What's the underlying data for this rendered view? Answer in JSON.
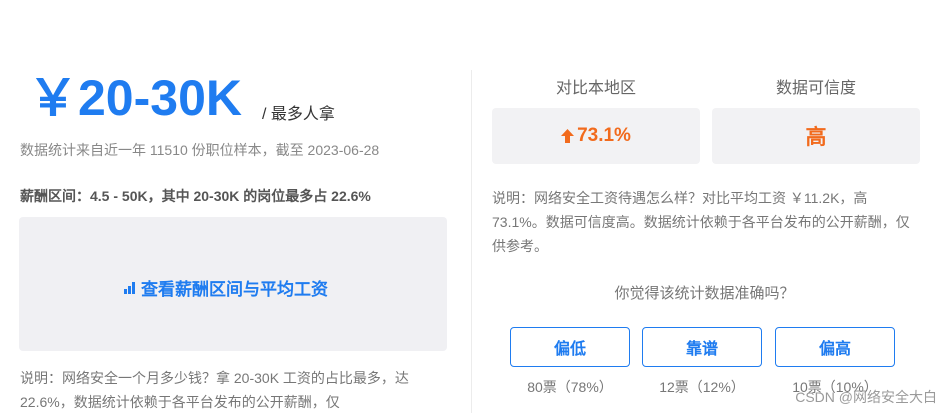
{
  "salary": {
    "amount": "￥20-30K",
    "suffix": "/ 最多人拿",
    "source_text": "数据统计来自近一年 11510 份职位样本，截至 2023-06-28",
    "range_text": "薪酬区间：4.5 - 50K，其中 20-30K 的岗位最多占 22.6%",
    "cta_label": "查看薪酬区间与平均工资",
    "cta_icon": "bar-chart-icon",
    "note": "说明：网络安全一个月多少钱？拿 20-30K 工资的占比最多，达 22.6%，数据统计依赖于各平台发布的公开薪酬，仅"
  },
  "comparison": {
    "local_header": "对比本地区",
    "local_value": "73.1%",
    "local_icon": "arrow-up-icon",
    "credibility_header": "数据可信度",
    "credibility_value": "高",
    "accent_color": "#f26b1d",
    "note": "说明：网络安全工资待遇怎么样？对比平均工资 ￥11.2K，高 73.1%。数据可信度高。数据统计依赖于各平台发布的公开薪酬，仅供参考。"
  },
  "poll": {
    "question": "你觉得该统计数据准确吗？",
    "options": [
      {
        "label": "偏低",
        "count": "80票（78%）"
      },
      {
        "label": "靠谱",
        "count": "12票（12%）"
      },
      {
        "label": "偏高",
        "count": "10票（10%）"
      }
    ]
  },
  "watermark": "CSDN @网络安全大白",
  "brand_color": "#1f7cf0"
}
